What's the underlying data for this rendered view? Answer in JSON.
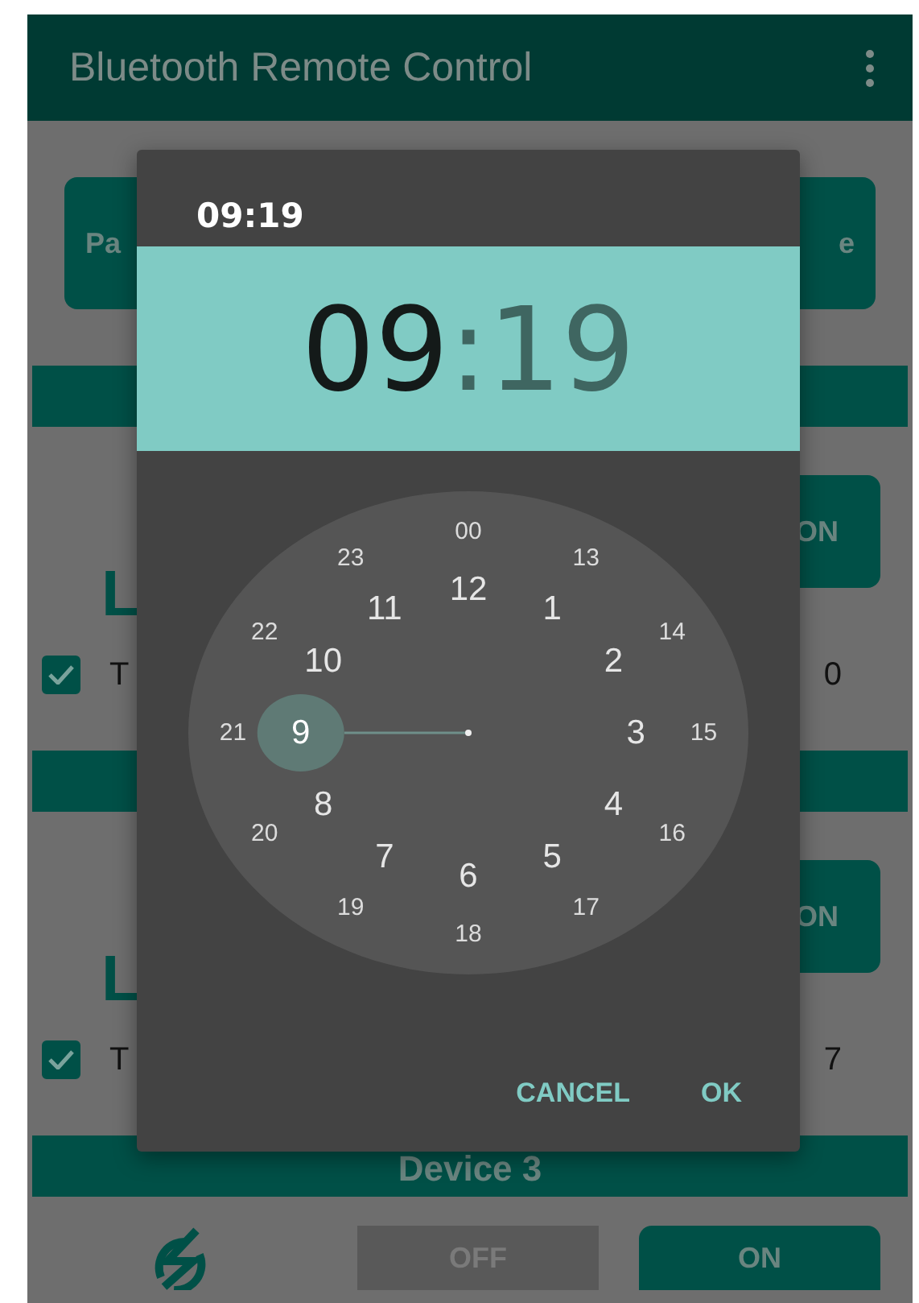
{
  "app_bar": {
    "title": "Bluetooth Remote Control"
  },
  "background": {
    "top_buttons": [
      "Pa",
      "e"
    ],
    "devices": [
      {
        "on_button": "ON",
        "label": "L",
        "checkbox": {
          "label": "T",
          "checked": true
        },
        "trailing": "0"
      },
      {
        "on_button": "ON",
        "label": "L",
        "checkbox": {
          "label": "T",
          "checked": true
        },
        "trailing": "7"
      }
    ],
    "device_3": {
      "title": "Device 3",
      "off_button": "OFF",
      "on_button": "ON"
    }
  },
  "dialog": {
    "header_time": "09:19",
    "hours": "09",
    "separator": ":",
    "minutes": "19",
    "inner_ring": [
      {
        "label": "12",
        "selected": false
      },
      {
        "label": "1",
        "selected": false
      },
      {
        "label": "2",
        "selected": false
      },
      {
        "label": "3",
        "selected": false
      },
      {
        "label": "4",
        "selected": false
      },
      {
        "label": "5",
        "selected": false
      },
      {
        "label": "6",
        "selected": false
      },
      {
        "label": "7",
        "selected": false
      },
      {
        "label": "8",
        "selected": false
      },
      {
        "label": "9",
        "selected": true
      },
      {
        "label": "10",
        "selected": false
      },
      {
        "label": "11",
        "selected": false
      }
    ],
    "outer_ring": [
      {
        "label": "00",
        "selected": false
      },
      {
        "label": "13",
        "selected": false
      },
      {
        "label": "14",
        "selected": false
      },
      {
        "label": "15",
        "selected": false
      },
      {
        "label": "16",
        "selected": false
      },
      {
        "label": "17",
        "selected": false
      },
      {
        "label": "18",
        "selected": false
      },
      {
        "label": "19",
        "selected": false
      },
      {
        "label": "20",
        "selected": false
      },
      {
        "label": "21",
        "selected": false
      },
      {
        "label": "22",
        "selected": false
      },
      {
        "label": "23",
        "selected": false
      }
    ],
    "buttons": [
      "CANCEL",
      "OK"
    ]
  }
}
